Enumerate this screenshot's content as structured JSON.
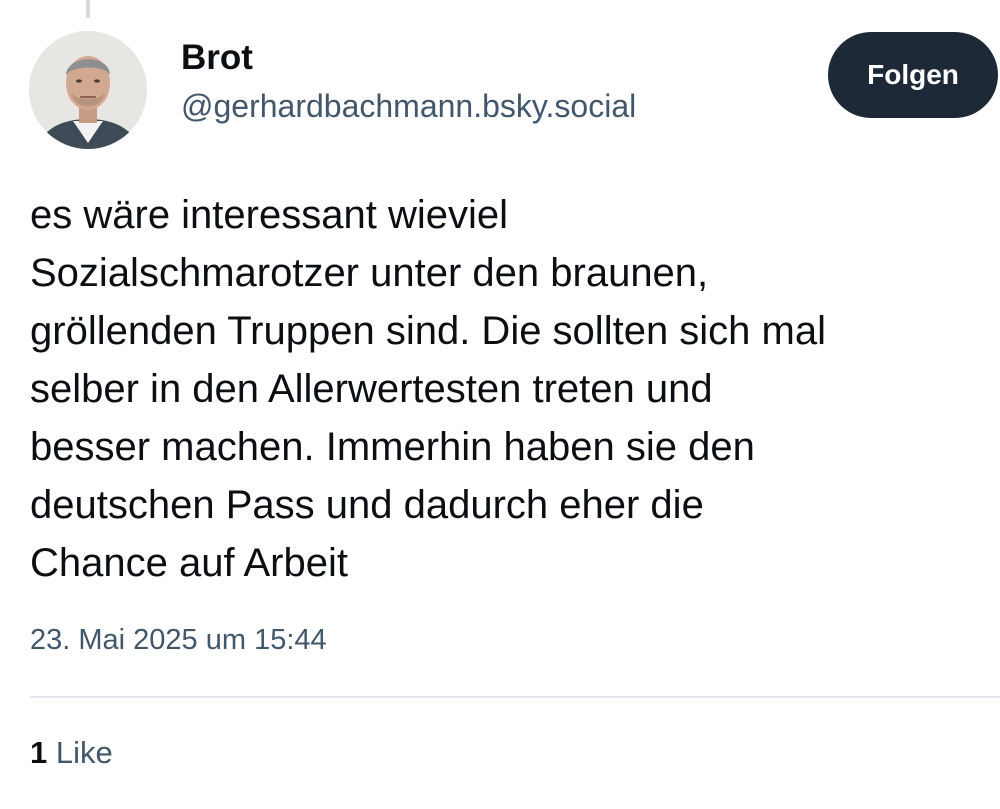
{
  "author": {
    "display_name": "Brot",
    "handle": "@gerhardbachmann.bsky.social",
    "avatar_icon": "profile-photo"
  },
  "follow_button": {
    "label": "Folgen"
  },
  "post": {
    "text_lines": [
      "es wäre interessant wieviel",
      "Sozialschmarotzer unter den braunen,",
      "gröllenden Truppen sind. Die sollten sich mal",
      "selber in den Allerwertesten treten und",
      "besser machen. Immerhin haben sie den",
      "deutschen Pass und dadurch eher die",
      "Chance auf Arbeit"
    ],
    "timestamp": "23. Mai 2025 um 15:44"
  },
  "stats": {
    "like_count": "1",
    "like_label": "Like"
  },
  "colors": {
    "follow_button_bg": "#1e2937",
    "secondary_text": "#42576c",
    "primary_text": "#0b0f14",
    "divider": "#e3e8ec"
  }
}
